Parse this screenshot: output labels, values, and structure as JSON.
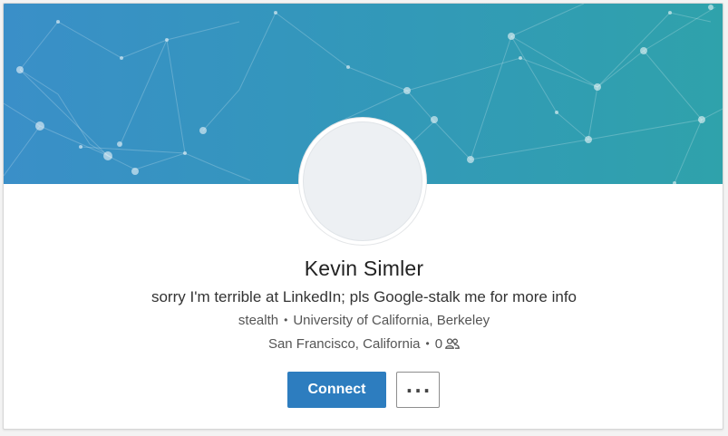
{
  "profile": {
    "name": "Kevin Simler",
    "headline": "sorry I'm terrible at LinkedIn; pls Google-stalk me for more info",
    "company": "stealth",
    "school": "University of California, Berkeley",
    "location": "San Francisco, California",
    "connections": "0",
    "separator": "•"
  },
  "actions": {
    "connect_label": "Connect",
    "more_label": "..."
  },
  "icons": {
    "connections": "people-icon",
    "more": "ellipsis-icon"
  },
  "colors": {
    "banner_left": "#3a8fc8",
    "banner_right": "#2fa2ab",
    "primary_button": "#2d7dbf"
  }
}
